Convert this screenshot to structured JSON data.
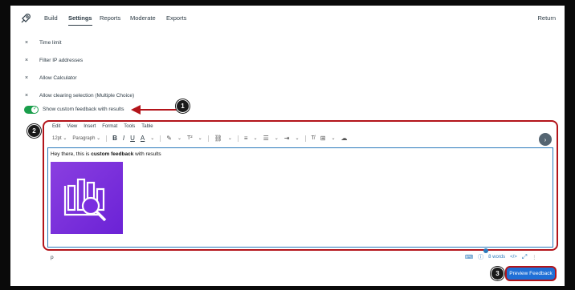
{
  "nav": {
    "tabs": [
      {
        "label": "Build"
      },
      {
        "label": "Settings"
      },
      {
        "label": "Reports"
      },
      {
        "label": "Moderate"
      },
      {
        "label": "Exports"
      }
    ],
    "return_label": "Return"
  },
  "settings": [
    {
      "label": "Time limit"
    },
    {
      "label": "Filter IP addresses"
    },
    {
      "label": "Allow Calculator"
    },
    {
      "label": "Allow clearing selection (Multiple Choice)"
    }
  ],
  "remove_glyph": "×",
  "toggle": {
    "label": "Show custom feedback with results",
    "on": true
  },
  "callouts": [
    "1",
    "2",
    "3"
  ],
  "editor": {
    "menu": [
      "Edit",
      "View",
      "Insert",
      "Format",
      "Tools",
      "Table"
    ],
    "font_size": "12pt",
    "block_format": "Paragraph",
    "toolbar_glyphs": {
      "bold": "B",
      "italic": "I",
      "underline": "U"
    },
    "content_prefix": "Hey there, this is ",
    "content_bold": "custom feedback",
    "content_suffix": " with results",
    "path_label": "p",
    "word_count": "8 words",
    "code_glyph": "</>",
    "more_glyph": "›"
  },
  "preview_button": "Preview Feedback",
  "colors": {
    "accent": "#1f6fd6",
    "toggle_on": "#1a9e4b",
    "annotation": "#b3141a",
    "image_bg": "#7a2ee0"
  }
}
